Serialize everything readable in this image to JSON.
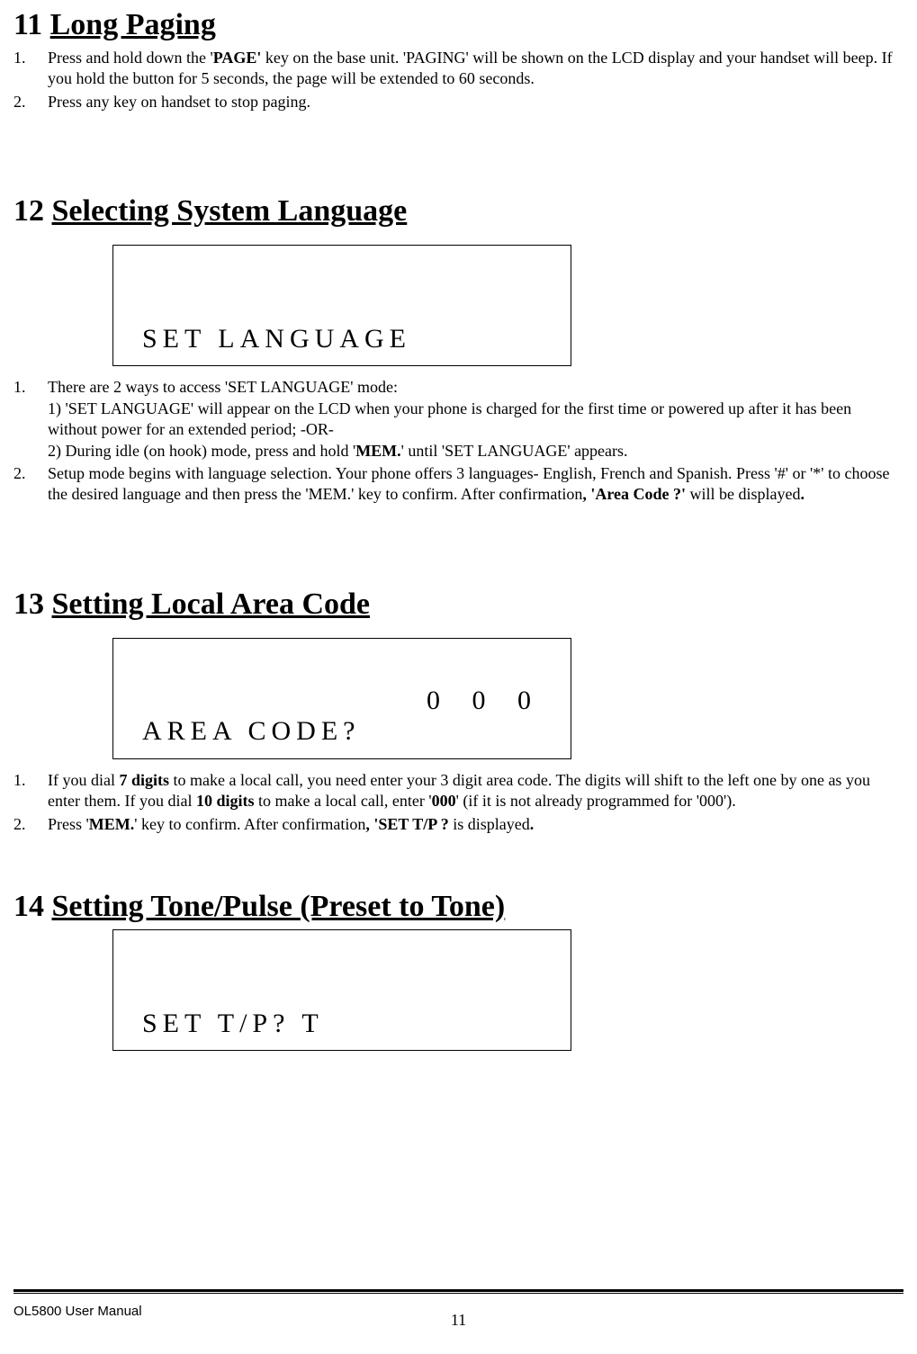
{
  "sections": {
    "s11": {
      "num": "11",
      "title": "Long Paging",
      "items": {
        "i1_num": "1.",
        "i1_body_a": "Press and hold down the '",
        "i1_body_b": "PAGE'",
        "i1_body_c": " key on the base unit. 'PAGING' will be shown on the LCD display and your handset will beep. If you hold the button for 5 seconds, the page will be extended to 60 seconds.",
        "i2_num": "2.",
        "i2_body": "Press any key on handset to stop paging."
      }
    },
    "s12": {
      "num": "12",
      "title": "Selecting System Language",
      "lcd": "SET LANGUAGE",
      "items": {
        "i1_num": "1.",
        "i1_line1": "There are 2 ways to access 'SET LANGUAGE' mode:",
        "i1_line2": "1) 'SET LANGUAGE' will appear on the LCD when your phone is charged for the first time or powered up after it has been without power for an extended period; -OR-",
        "i1_line3_a": "2) During idle (on hook) mode, press and hold '",
        "i1_line3_b": "MEM.",
        "i1_line3_c": "' until 'SET LANGUAGE' appears.",
        "i2_num": "2.",
        "i2_a": "Setup mode begins with language selection. Your phone offers 3 languages- English, French and Spanish. Press '#' or '*' to choose the desired language and then press the 'MEM.' key to confirm. After confirmation",
        "i2_b": ", 'Area Code ?'",
        "i2_c": " will be displayed",
        "i2_d": "."
      }
    },
    "s13": {
      "num": "13",
      "title": "Setting Local Area Code",
      "lcd_line1": "0 0 0",
      "lcd_line2": "AREA CODE?",
      "items": {
        "i1_num": "1.",
        "i1_a": "If you dial ",
        "i1_b": "7 digits",
        "i1_c": " to make a local call, you need enter your 3 digit area code. The digits will shift to the left one by one as you enter them.  If you dial ",
        "i1_d": "10 digits",
        "i1_e": " to make a local call, enter '",
        "i1_f": "000",
        "i1_g": "' (if it is not already programmed for '000').",
        "i2_num": "2.",
        "i2_a": "Press '",
        "i2_b": "MEM.",
        "i2_c": "' key to confirm. After confirmation",
        "i2_d": ", 'SET T/P ?",
        "i2_e": " is displayed",
        "i2_f": "."
      }
    },
    "s14": {
      "num": "14",
      "title": "Setting Tone/Pulse (Preset to Tone)",
      "lcd": "SET T/P?  T"
    }
  },
  "footer": {
    "left": "OL5800 User Manual",
    "page": "11"
  }
}
